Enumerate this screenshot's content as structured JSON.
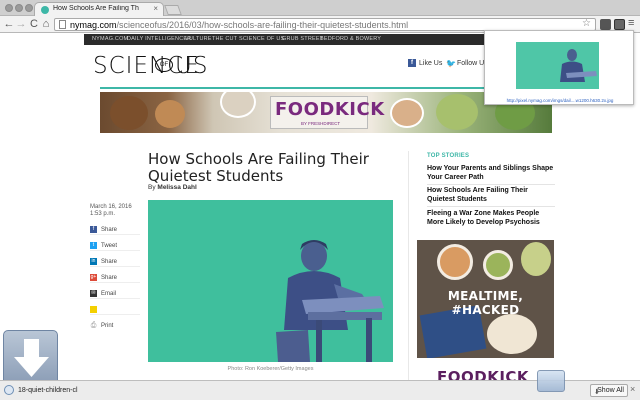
{
  "browser": {
    "tab": {
      "title": "How Schools Are Failing Th",
      "close": "×"
    },
    "nav": {
      "back": "←",
      "forward": "→",
      "reload": "C",
      "home": "⌂",
      "menu": "≡"
    },
    "url": {
      "host": "nymag.com",
      "path": "/scienceofus/2016/03/how-schools-are-failing-their-quietest-students.html"
    }
  },
  "site_nav": [
    "NYMAG.COM",
    "DAILY INTELLIGENCER",
    "VULTURE",
    "THE CUT",
    "SCIENCE OF US",
    "GRUB STREET",
    "BEDFORD & BOWERY"
  ],
  "logo": {
    "part1": "SCIENCE",
    "of": "OF",
    "part2": "US"
  },
  "social": {
    "like": "Like Us",
    "follow": "Follow Us"
  },
  "ad_banner": {
    "title": "FOODKICK",
    "subtitle": "BY FRESHDIRECT"
  },
  "article": {
    "headline": "How Schools Are Failing Their Quietest Students",
    "byline_prefix": "By ",
    "author": "Melissa Dahl",
    "date": "March 16, 2016",
    "time": "1:53 p.m.",
    "caption": "Photo: Ron Koeberer/Getty Images"
  },
  "share": [
    {
      "label": "Share",
      "icon": "facebook-icon",
      "glyph": "f",
      "color": "#3b5998"
    },
    {
      "label": "Tweet",
      "icon": "twitter-icon",
      "glyph": "t",
      "color": "#1da1f2"
    },
    {
      "label": "Share",
      "icon": "linkedin-icon",
      "glyph": "in",
      "color": "#0077b5"
    },
    {
      "label": "Share",
      "icon": "googleplus-icon",
      "glyph": "g+",
      "color": "#dd4b39"
    },
    {
      "label": "Email",
      "icon": "email-icon",
      "glyph": "✉",
      "color": "#333333"
    },
    {
      "label": "",
      "icon": "comment-icon",
      "glyph": "",
      "color": "#f4d000"
    },
    {
      "label": "Print",
      "icon": "print-icon",
      "glyph": "⎙",
      "color": "#888888"
    }
  ],
  "sidebar": {
    "heading": "TOP STORIES",
    "stories": [
      "How Your Parents and Siblings Shape Your Career Path",
      "How Schools Are Failing Their Quietest Students",
      "Fleeing a War Zone Makes People More Likely to Develop Psychosis"
    ],
    "ad_text": "MEALTIME, #HACKED",
    "ad_brand": "FOODKICK"
  },
  "popup": {
    "url": "http://pixel.nymag.com/imgs/dail....w1200.h630.2x.jpg"
  },
  "download_shelf": {
    "filename": "18-quiet-children-cl",
    "show_all": "Show All",
    "close": "×"
  },
  "colors": {
    "accent": "#3db7a7",
    "hero_bg": "#3fbf9d",
    "foodkick": "#7a2a7e"
  }
}
